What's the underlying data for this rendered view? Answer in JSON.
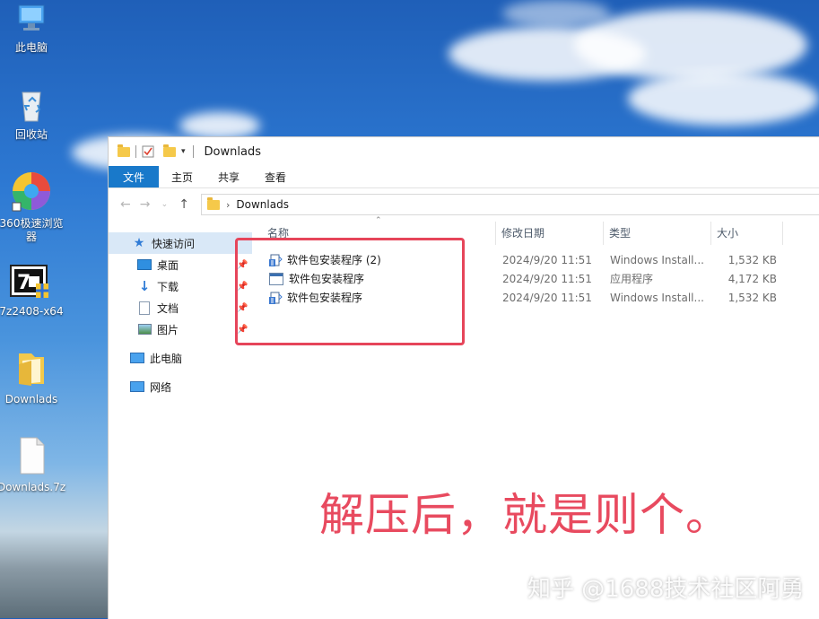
{
  "desktop": {
    "icons": [
      {
        "label": "此电脑",
        "icon": "computer-icon"
      },
      {
        "label": "回收站",
        "icon": "recycle-bin-icon"
      },
      {
        "label": "360极速浏览器",
        "icon": "browser-360-icon"
      },
      {
        "label": "7z2408-x64",
        "icon": "7zip-installer-icon"
      },
      {
        "label": "Downlads",
        "icon": "folder-icon"
      },
      {
        "label": "Downlads.7z",
        "icon": "file-icon"
      }
    ]
  },
  "explorer": {
    "title": "Downlads",
    "ribbon": {
      "file": "文件",
      "home": "主页",
      "share": "共享",
      "view": "查看"
    },
    "address": {
      "current": "Downlads"
    },
    "nav": {
      "quick_access": "快速访问",
      "desktop": "桌面",
      "downloads": "下载",
      "documents": "文档",
      "pictures": "图片",
      "this_pc": "此电脑",
      "network": "网络"
    },
    "columns": {
      "name": "名称",
      "modified": "修改日期",
      "type": "类型",
      "size": "大小"
    },
    "files": [
      {
        "name": "软件包安装程序 (2)",
        "modified": "2024/9/20 11:51",
        "type": "Windows Install...",
        "size": "1,532 KB",
        "icon": "msi-installer-icon"
      },
      {
        "name": "软件包安装程序",
        "modified": "2024/9/20 11:51",
        "type": "应用程序",
        "size": "4,172 KB",
        "icon": "exe-application-icon"
      },
      {
        "name": "软件包安装程序",
        "modified": "2024/9/20 11:51",
        "type": "Windows Install...",
        "size": "1,532 KB",
        "icon": "msi-installer-icon"
      }
    ]
  },
  "annotation": {
    "text": "解压后，就是则个。",
    "color": "#e84a5f"
  },
  "watermark": {
    "text": "知乎 @1688技术社区阿勇"
  },
  "colors": {
    "file_tab": "#1979ca",
    "nav_selected": "#d9e8f7",
    "highlight_box": "#e6455a"
  }
}
